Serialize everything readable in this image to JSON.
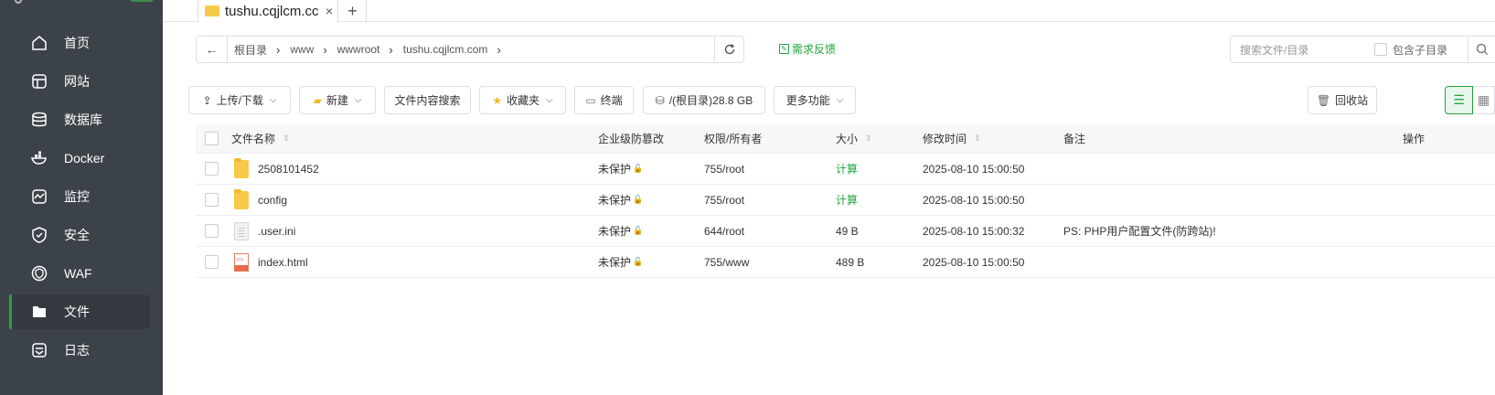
{
  "sidebar": {
    "items": [
      {
        "label": "首页",
        "icon": "home-icon"
      },
      {
        "label": "网站",
        "icon": "website-icon"
      },
      {
        "label": "数据库",
        "icon": "database-icon"
      },
      {
        "label": "Docker",
        "icon": "docker-icon"
      },
      {
        "label": "监控",
        "icon": "monitor-icon"
      },
      {
        "label": "安全",
        "icon": "shield-icon"
      },
      {
        "label": "WAF",
        "icon": "waf-icon"
      },
      {
        "label": "文件",
        "icon": "folder-icon",
        "active": true
      },
      {
        "label": "日志",
        "icon": "log-icon"
      }
    ]
  },
  "tabs": [
    {
      "label": "tushu.cqjlcm.cc",
      "close": "×"
    }
  ],
  "tab_add": "+",
  "address": {
    "back": "←",
    "crumbs": [
      "根目录",
      "www",
      "wwwroot",
      "tushu.cqjlcm.com"
    ],
    "separator": "›"
  },
  "feedback": "需求反馈",
  "search": {
    "placeholder": "搜索文件/目录",
    "include_sub_label": "包含子目录"
  },
  "toolbar": {
    "upload": "上传/下载",
    "new": "新建",
    "content_search": "文件内容搜索",
    "favorites": "收藏夹",
    "terminal": "终端",
    "disk": "/(根目录)28.8 GB",
    "more": "更多功能",
    "recycle": "回收站"
  },
  "table": {
    "headers": {
      "name": "文件名称",
      "tamper": "企业级防篡改",
      "perm": "权限/所有者",
      "size": "大小",
      "mtime": "修改时间",
      "note": "备注",
      "ops": "操作"
    },
    "rows": [
      {
        "name": "2508101452",
        "type": "folder",
        "tamper": "未保护",
        "perm": "755/root",
        "size": "计算",
        "size_link": true,
        "mtime": "2025-08-10 15:00:50",
        "note": ""
      },
      {
        "name": "config",
        "type": "folder",
        "tamper": "未保护",
        "perm": "755/root",
        "size": "计算",
        "size_link": true,
        "mtime": "2025-08-10 15:00:50",
        "note": ""
      },
      {
        "name": ".user.ini",
        "type": "ini",
        "tamper": "未保护",
        "perm": "644/root",
        "size": "49 B",
        "size_link": false,
        "mtime": "2025-08-10 15:00:32",
        "note": "PS: PHP用户配置文件(防跨站)!"
      },
      {
        "name": "index.html",
        "type": "html",
        "tamper": "未保护",
        "perm": "755/www",
        "size": "489 B",
        "size_link": false,
        "mtime": "2025-08-10 15:00:50",
        "note": ""
      }
    ]
  },
  "colors": {
    "sidebar_bg": "#3c4249",
    "accent": "#20a53a",
    "folder": "#f7c948"
  }
}
